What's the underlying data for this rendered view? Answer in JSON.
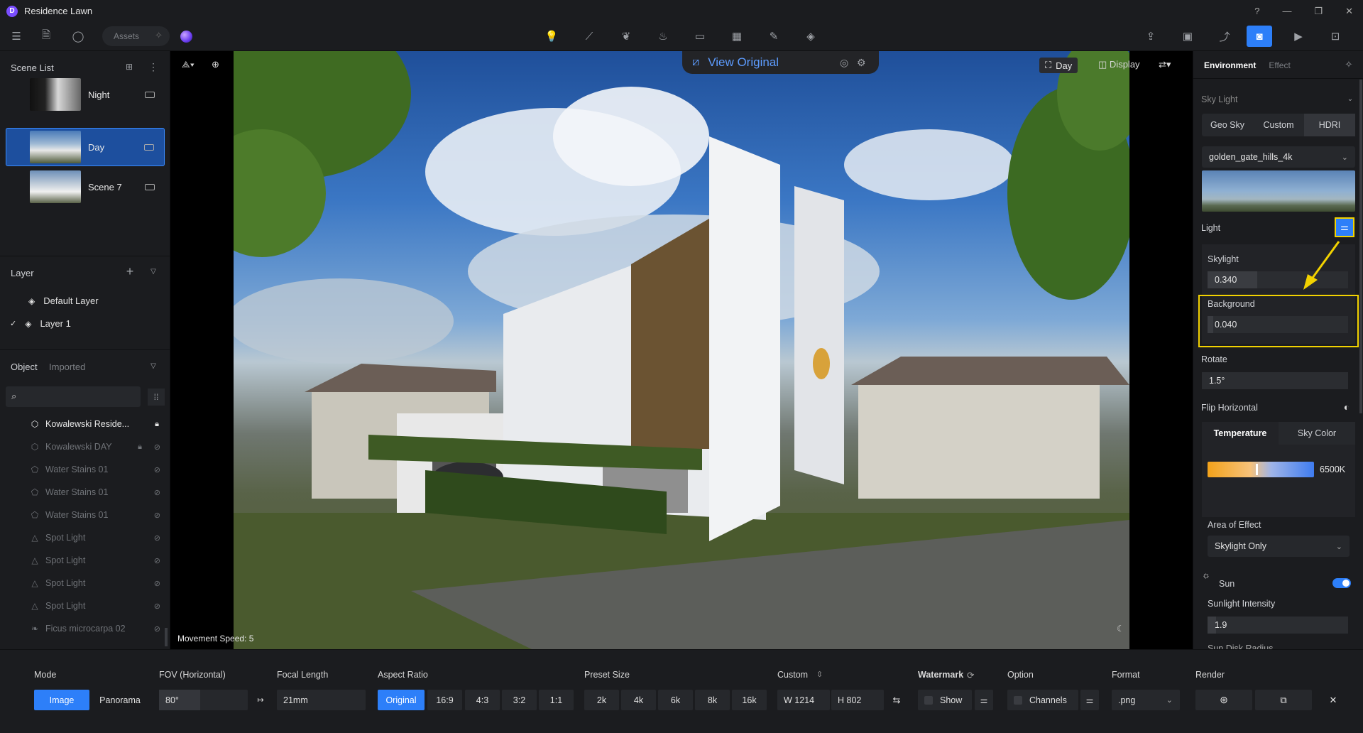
{
  "app": {
    "title": "Residence Lawn"
  },
  "toolbar": {
    "assets_placeholder": "Assets"
  },
  "scene_list": {
    "title": "Scene List",
    "scenes": [
      {
        "label": "Night",
        "selected": false
      },
      {
        "label": "Day",
        "selected": true
      },
      {
        "label": "Scene 7",
        "selected": false
      }
    ]
  },
  "layers": {
    "title": "Layer",
    "items": [
      {
        "label": "Default Layer",
        "checked": false
      },
      {
        "label": "Layer 1",
        "checked": true
      }
    ]
  },
  "objects": {
    "tabs": [
      "Object",
      "Imported"
    ],
    "items": [
      {
        "label": "Kowalewski Reside...",
        "icon": "cube-icon",
        "active": true
      },
      {
        "label": "Kowalewski DAY",
        "icon": "cube-icon",
        "active": false
      },
      {
        "label": "Water Stains 01",
        "icon": "decal-icon",
        "active": false
      },
      {
        "label": "Water Stains 01",
        "icon": "decal-icon",
        "active": false
      },
      {
        "label": "Water Stains 01",
        "icon": "decal-icon",
        "active": false
      },
      {
        "label": "Spot Light",
        "icon": "spotlight-icon",
        "active": false
      },
      {
        "label": "Spot Light",
        "icon": "spotlight-icon",
        "active": false
      },
      {
        "label": "Spot Light",
        "icon": "spotlight-icon",
        "active": false
      },
      {
        "label": "Spot Light",
        "icon": "spotlight-icon",
        "active": false
      },
      {
        "label": "Ficus microcarpa 02",
        "icon": "plant-icon",
        "active": false
      }
    ]
  },
  "viewport": {
    "view_original": "View Original",
    "day_label": "Day",
    "display_label": "Display",
    "movement_speed": "Movement Speed: 5"
  },
  "environment": {
    "tabs": [
      "Environment",
      "Effect"
    ],
    "sky_light_label": "Sky Light",
    "sky_modes": [
      "Geo Sky",
      "Custom",
      "HDRI"
    ],
    "sky_mode_selected": "HDRI",
    "hdri_name": "golden_gate_hills_4k",
    "light_label": "Light",
    "skylight_label": "Skylight",
    "skylight_value": "0.340",
    "background_label": "Background",
    "background_value": "0.040",
    "rotate_label": "Rotate",
    "rotate_value": "1.5°",
    "flip_label": "Flip Horizontal",
    "temp_tabs": [
      "Temperature",
      "Sky Color"
    ],
    "temperature_value": "6500K",
    "area_label": "Area of Effect",
    "area_value": "Skylight Only",
    "sun_label": "Sun",
    "sun_on": true,
    "sunlight_label": "Sunlight Intensity",
    "sunlight_value": "1.9",
    "sun_disk_label": "Sun Disk Radius"
  },
  "bottom": {
    "mode_label": "Mode",
    "mode_image": "Image",
    "mode_panorama": "Panorama",
    "fov_label": "FOV (Horizontal)",
    "fov_value": "80°",
    "focal_label": "Focal Length",
    "focal_value": "21mm",
    "aspect_label": "Aspect Ratio",
    "aspect_options": [
      "Original",
      "16:9",
      "4:3",
      "3:2",
      "1:1"
    ],
    "preset_label": "Preset Size",
    "preset_options": [
      "2k",
      "4k",
      "6k",
      "8k",
      "16k"
    ],
    "custom_label": "Custom",
    "width_value": "W  1214",
    "height_value": "H  802",
    "watermark_label": "Watermark",
    "watermark_show": "Show",
    "option_label": "Option",
    "channels_label": "Channels",
    "format_label": "Format",
    "format_value": ".png",
    "render_label": "Render"
  }
}
